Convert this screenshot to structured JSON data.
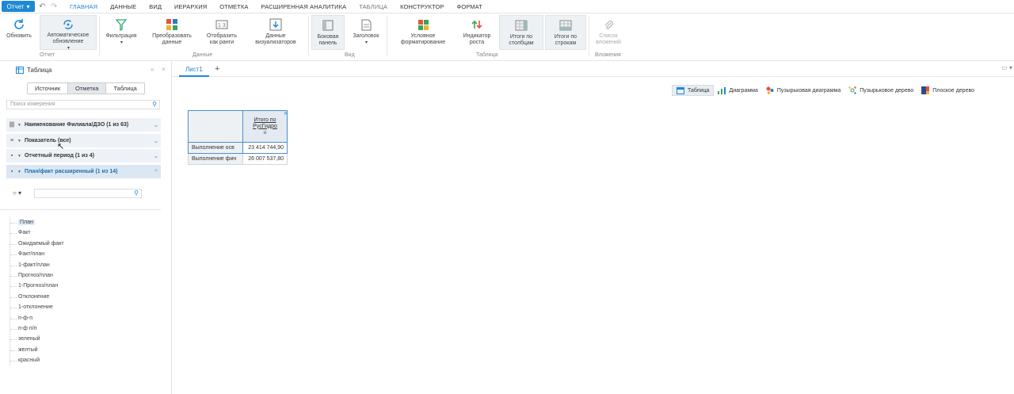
{
  "menubar": {
    "report_label": "Отчет",
    "tabs": [
      {
        "label": "ГЛАВНАЯ",
        "state": "active"
      },
      {
        "label": "ДАННЫЕ",
        "state": "normal"
      },
      {
        "label": "ВИД",
        "state": "normal"
      },
      {
        "label": "ИЕРАРХИЯ",
        "state": "normal"
      },
      {
        "label": "ОТМЕТКА",
        "state": "normal"
      },
      {
        "label": "РАСШИРЕННАЯ АНАЛИТИКА",
        "state": "normal"
      },
      {
        "label": "ТАБЛИЦА",
        "state": "muted"
      },
      {
        "label": "КОНСТРУКТОР",
        "state": "normal"
      },
      {
        "label": "ФОРМАТ",
        "state": "normal"
      }
    ]
  },
  "ribbon": {
    "refresh": "Обновить",
    "auto_refresh": "Автоматическое\nобновление",
    "filter": "Фильтрация",
    "transform": "Преобразовать\nданные",
    "ranks": "Отобразить\nкак ранги",
    "visualizer_data": "Данные\nвизуализаторов",
    "side_panel": "Боковая\nпанель",
    "header": "Заголовок",
    "cond_format": "Условное\nформатирование",
    "growth": "Индикатор\nроста",
    "col_totals": "Итоги по\nстолбцам",
    "row_totals": "Итоги по\nстрокам",
    "attachments": "Список\nвложений",
    "groups": {
      "report": "Отчет",
      "data": "Данные",
      "view": "Вид",
      "table": "Таблица",
      "attachments": "Вложения"
    }
  },
  "left_panel": {
    "title": "Таблица",
    "segments": [
      "Источник",
      "Отметка",
      "Таблица"
    ],
    "search_placeholder": "Поиск измерения",
    "dimensions": [
      "Наименование Филиала/ДЗО (1 из 63)",
      "Показатель (все)",
      "Отчетный период (1 из 4)",
      "План/факт расширенный (1 из 14)"
    ],
    "tree_items": [
      "План",
      "Факт",
      "Ожидаемый факт",
      "Факт/план",
      "1-факт/план",
      "Прогноз/план",
      "1-Прогноз/план",
      "Отклонение",
      "1-отклонение",
      "п-ф-п",
      "п-ф п/п",
      "зеленый",
      "желтый",
      "красный"
    ]
  },
  "sheets": {
    "tab": "Лист1",
    "add": "+"
  },
  "views": [
    "Таблица",
    "Диаграмма",
    "Пузырьковая диаграмма",
    "Пузырьковое дерево",
    "Плоское дерево"
  ],
  "grid": {
    "col_header": "Итого по РусГидро",
    "rows": [
      {
        "label": "Выполнение осв",
        "value": "23 414 744,90"
      },
      {
        "label": "Выполнение фин",
        "value": "26 007 537,80"
      }
    ]
  }
}
